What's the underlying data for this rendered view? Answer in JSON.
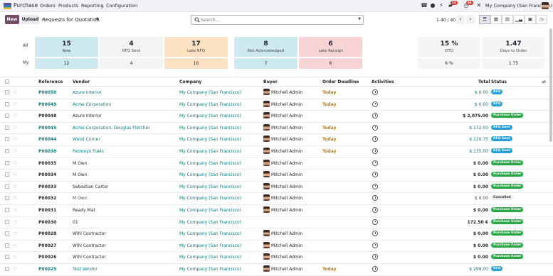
{
  "navbar": {
    "app_name": "Purchase",
    "menu": [
      "Orders",
      "Products",
      "Reporting",
      "Configuration"
    ],
    "badges": [
      "13",
      "64"
    ],
    "company": "My Company (San Francisco)"
  },
  "control": {
    "new_label": "New",
    "upload_label": "Upload",
    "title": "Requests for Quotation",
    "search_placeholder": "Search...",
    "pager": "1-40 / 40"
  },
  "dashboard": {
    "row_labels": [
      "All",
      "My"
    ],
    "tiles": [
      {
        "num": "15",
        "label": "New",
        "my": "12",
        "bg": "#cde8ee",
        "mybg": "#cde8ee"
      },
      {
        "num": "4",
        "label": "RFQ Sent",
        "my": "4",
        "bg": "#f2f3f5",
        "mybg": "#f2f3f5"
      },
      {
        "num": "17",
        "label": "Late RFQ",
        "my": "16",
        "bg": "#fce2c3",
        "mybg": "#fce2c3"
      },
      {
        "num": "8",
        "label": "Not Acknowledged",
        "my": "7",
        "bg": "#cde8ee",
        "mybg": "#cde8ee"
      },
      {
        "num": "6",
        "label": "Late Receipt",
        "my": "6",
        "bg": "#f6d3d5",
        "mybg": "#f6d3d5"
      }
    ],
    "kpis": [
      {
        "num": "15 %",
        "label": "OTD",
        "my": "6 %"
      },
      {
        "num": "1.47",
        "label": "Days to Order",
        "my": "1.75"
      }
    ]
  },
  "table": {
    "headers": [
      "Reference",
      "Vendor",
      "Company",
      "Buyer",
      "Order Deadline",
      "Activities",
      "Total",
      "Status"
    ],
    "rows": [
      {
        "ref": "P00050",
        "vendor": "Azure Interior",
        "company": "My Company (San Francisco)",
        "buyer": "Mitchell Admin",
        "deadline": "Today",
        "total": "$ 0.00",
        "status": "RFQ",
        "rfq": true
      },
      {
        "ref": "P00049",
        "vendor": "Acme Corporation",
        "company": "My Company (San Francisco)",
        "buyer": "Mitchell Admin",
        "deadline": "Today",
        "total": "$ 0.00",
        "status": "RFQ",
        "rfq": true
      },
      {
        "ref": "P00048",
        "vendor": "Azure Interior",
        "company": "My Company (San Francisco)",
        "buyer": "Mitchell Admin",
        "deadline": "",
        "total": "$ 2,075.00",
        "status": "Purchase Order",
        "rfq": false
      },
      {
        "ref": "P00045",
        "vendor": "Acme Corporation, Douglas Fletcher",
        "company": "My Company (San Francisco)",
        "buyer": "Mitchell Admin",
        "deadline": "Today",
        "total": "$ 172.50",
        "status": "RFQ Sent",
        "rfq": true
      },
      {
        "ref": "P00044",
        "vendor": "Wood Corner",
        "company": "My Company (San Francisco)",
        "buyer": "Mitchell Admin",
        "deadline": "Today",
        "total": "$ 120.75",
        "status": "RFQ Sent",
        "rfq": true
      },
      {
        "ref": "P00038",
        "vendor": "Petronyx Fuels",
        "company": "My Company (San Francisco)",
        "buyer": "Mitchell Admin",
        "deadline": "Today",
        "total": "$ 135.00",
        "status": "RFQ Sent",
        "rfq": true
      },
      {
        "ref": "P00035",
        "vendor": "M Own",
        "company": "My Company (San Francisco)",
        "buyer": "Mitchell Admin",
        "deadline": "",
        "total": "$ 0.00",
        "status": "Purchase Order",
        "rfq": false
      },
      {
        "ref": "P00034",
        "vendor": "M Own",
        "company": "My Company (San Francisco)",
        "buyer": "Mitchell Admin",
        "deadline": "",
        "total": "$ 0.00",
        "status": "Purchase Order",
        "rfq": false
      },
      {
        "ref": "P00033",
        "vendor": "Sebastian Carter",
        "company": "My Company (San Francisco)",
        "buyer": "Mitchell Admin",
        "deadline": "",
        "total": "$ 0.00",
        "status": "Purchase Order",
        "rfq": false
      },
      {
        "ref": "P00032",
        "vendor": "M Own",
        "company": "My Company (San Francisco)",
        "buyer": "Mitchell Admin",
        "deadline": "",
        "total": "$ 0.00",
        "status": "Cancelled",
        "rfq": false
      },
      {
        "ref": "P00031",
        "vendor": "Ready Mat",
        "company": "My Company (San Francisco)",
        "buyer": "Mitchell Admin",
        "deadline": "",
        "total": "$ 0.00",
        "status": "Purchase Order",
        "rfq": false
      },
      {
        "ref": "P00030",
        "vendor": "01",
        "company": "My Company (San Francisco)",
        "buyer": "",
        "deadline": "",
        "total": "172.50 €",
        "status": "Purchase Order",
        "rfq": false
      },
      {
        "ref": "P00028",
        "vendor": "Wihl Contractor",
        "company": "My Company (San Francisco)",
        "buyer": "Mitchell Admin",
        "deadline": "",
        "total": "$ 0.00",
        "status": "Purchase Order",
        "rfq": false
      },
      {
        "ref": "P00027",
        "vendor": "Wihl Contractor",
        "company": "My Company (San Francisco)",
        "buyer": "Mitchell Admin",
        "deadline": "",
        "total": "$ 0.00",
        "status": "Purchase Order",
        "rfq": false
      },
      {
        "ref": "P00026",
        "vendor": "Wihl Contractor",
        "company": "My Company (San Francisco)",
        "buyer": "Mitchell Admin",
        "deadline": "",
        "total": "$ 0.00",
        "status": "Purchase Order",
        "rfq": false
      },
      {
        "ref": "P00025",
        "vendor": "Test Vendor",
        "company": "My Company (San Francisco)",
        "buyer": "Mitchell Admin",
        "deadline": "Today",
        "total": "$ 299.00",
        "status": "RFQ",
        "rfq": true
      }
    ]
  },
  "colors": {
    "brand": "#714b67",
    "link": "#017e84",
    "rfq_badge": "#2a9fd6",
    "po_badge": "#28a745",
    "cancelled_badge": "#e9ecef",
    "today": "#c57a00"
  }
}
